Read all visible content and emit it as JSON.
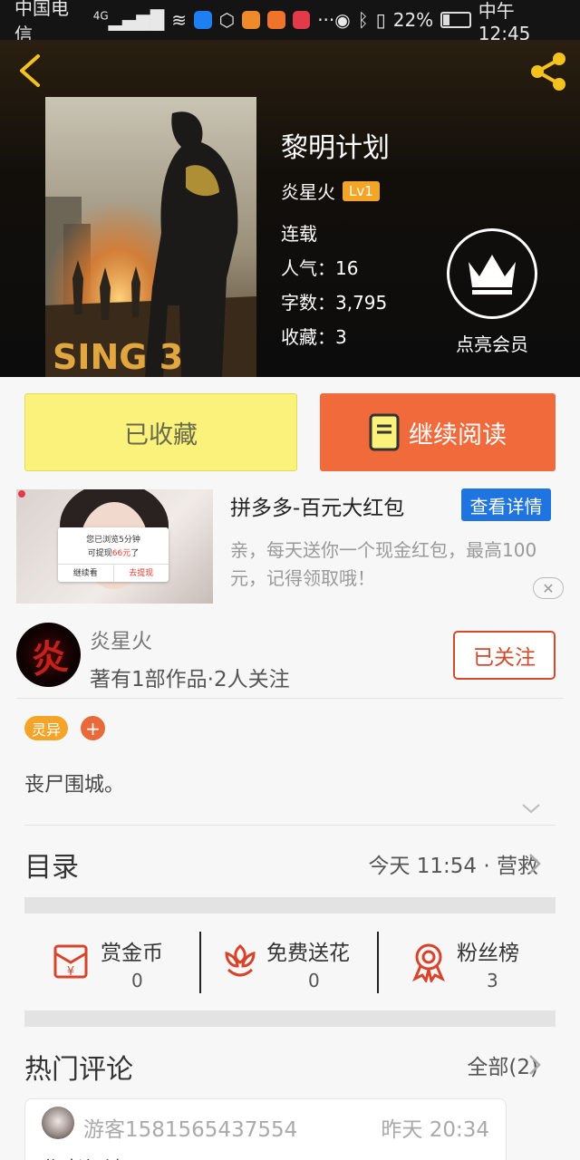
{
  "status_bar": {
    "carrier": "中国电信",
    "network": "4G",
    "battery": "22%",
    "time": "中午12:45",
    "more": "···"
  },
  "book": {
    "title": "黎明计划",
    "author": "炎星火",
    "author_level": "Lv1",
    "status": "连载",
    "popularity": "人气：16",
    "word_count": "字数：3,795",
    "favorites": "收藏：3",
    "cover_text": "SING 3"
  },
  "vip": {
    "label": "点亮会员"
  },
  "actions": {
    "collected": "已收藏",
    "continue_read": "继续阅读"
  },
  "ad": {
    "title": "拼多多-百元大红包",
    "detail_button": "查看详情",
    "description": "亲，每天送你一个现金红包，最高100元，记得领取哦！",
    "popup_line1": "您已浏览5分钟",
    "popup_line2_prefix": "可提现",
    "popup_amount": "66元",
    "popup_line2_suffix": "了",
    "popup_continue": "继续看",
    "popup_withdraw": "去提现",
    "close": "✕"
  },
  "author_card": {
    "avatar_char": "炎",
    "name": "炎星火",
    "stats": "著有1部作品·2人关注",
    "follow": "已关注"
  },
  "tags": {
    "tag": "灵异",
    "add": "+"
  },
  "intro": "丧尸围城。",
  "toc": {
    "title": "目录",
    "latest": "今天 11:54 · 营救"
  },
  "stats": {
    "reward": {
      "label": "赏金币",
      "value": "0"
    },
    "flower": {
      "label": "免费送花",
      "value": "0"
    },
    "fans": {
      "label": "粉丝榜",
      "value": "3"
    }
  },
  "comments": {
    "title": "热门评论",
    "all": "全部(2)",
    "items": [
      {
        "user": "游客1581565437554",
        "time": "昨天 20:34",
        "text": "作者加油"
      }
    ]
  },
  "colors": {
    "accent_orange": "#f06a3b",
    "collected_yellow": "#fbf27b",
    "tag_orange": "#f3a52a",
    "ad_blue": "#1f74e0",
    "icon_red": "#d8432c"
  }
}
